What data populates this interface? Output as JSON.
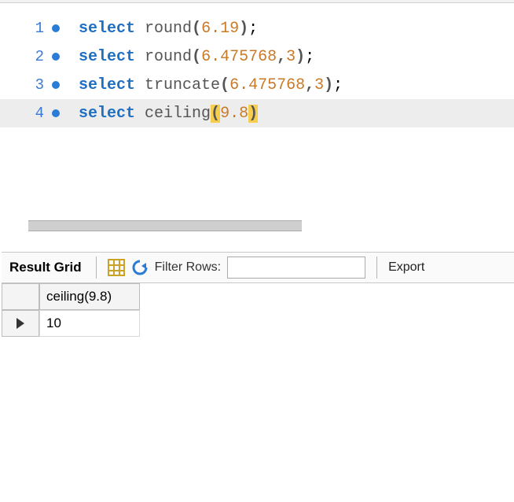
{
  "editor": {
    "lines": [
      {
        "num": "1",
        "current": false,
        "tokens": [
          {
            "t": "kw",
            "v": "select"
          },
          {
            "t": "sp",
            "v": " "
          },
          {
            "t": "fn",
            "v": "round"
          },
          {
            "t": "punc",
            "v": "("
          },
          {
            "t": "num",
            "v": "6.19"
          },
          {
            "t": "punc",
            "v": ")"
          },
          {
            "t": "punc-black",
            "v": ";"
          }
        ]
      },
      {
        "num": "2",
        "current": false,
        "tokens": [
          {
            "t": "kw",
            "v": "select"
          },
          {
            "t": "sp",
            "v": " "
          },
          {
            "t": "fn",
            "v": "round"
          },
          {
            "t": "punc",
            "v": "("
          },
          {
            "t": "num",
            "v": "6.475768"
          },
          {
            "t": "punc",
            "v": ","
          },
          {
            "t": "num",
            "v": "3"
          },
          {
            "t": "punc",
            "v": ")"
          },
          {
            "t": "punc-black",
            "v": ";"
          }
        ]
      },
      {
        "num": "3",
        "current": false,
        "tokens": [
          {
            "t": "kw",
            "v": "select"
          },
          {
            "t": "sp",
            "v": " "
          },
          {
            "t": "fn",
            "v": "truncate"
          },
          {
            "t": "punc",
            "v": "("
          },
          {
            "t": "num",
            "v": "6.475768"
          },
          {
            "t": "punc",
            "v": ","
          },
          {
            "t": "num",
            "v": "3"
          },
          {
            "t": "punc",
            "v": ")"
          },
          {
            "t": "punc-black",
            "v": ";"
          }
        ]
      },
      {
        "num": "4",
        "current": true,
        "tokens": [
          {
            "t": "kw",
            "v": "select"
          },
          {
            "t": "sp",
            "v": " "
          },
          {
            "t": "fn",
            "v": "ceiling"
          },
          {
            "t": "punc hl-paren",
            "v": "("
          },
          {
            "t": "num",
            "v": "9.8"
          },
          {
            "t": "punc hl-paren",
            "v": ")"
          }
        ]
      }
    ]
  },
  "results": {
    "label": "Result Grid",
    "filter_label": "Filter Rows:",
    "filter_value": "",
    "export_label": "Export",
    "columns": [
      "",
      "ceiling(9.8)"
    ],
    "rows": [
      {
        "pointer": true,
        "cells": [
          "10"
        ]
      }
    ]
  }
}
